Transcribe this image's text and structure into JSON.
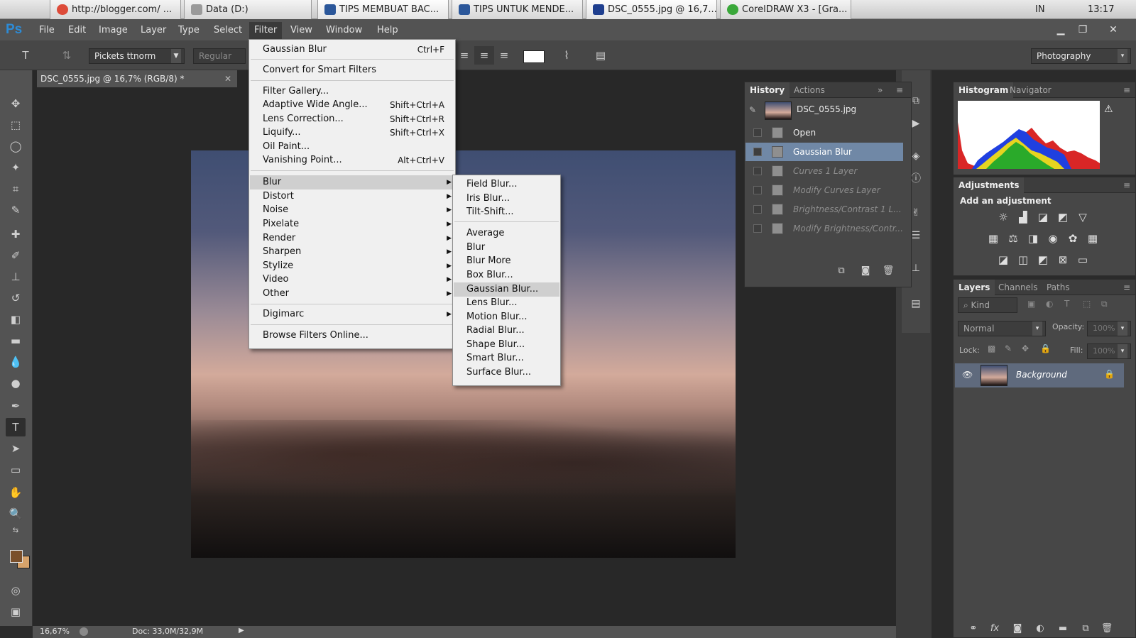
{
  "os": {
    "tabs": [
      {
        "label": "http://blogger.com/ ...",
        "color": "#dd4b39"
      },
      {
        "label": "Data (D:)",
        "color": "#9a9a9a"
      },
      {
        "label": "TIPS MEMBUAT BAC...",
        "color": "#2b579a"
      },
      {
        "label": "TIPS UNTUK MENDE...",
        "color": "#2b579a"
      },
      {
        "label": "DSC_0555.jpg @ 16,7...",
        "color": "#1f3f8f"
      },
      {
        "label": "CorelDRAW X3 - [Gra...",
        "color": "#3aa83a"
      }
    ],
    "lang": "IN",
    "clock": "13:17"
  },
  "app": {
    "logo": "Ps",
    "menu": [
      "File",
      "Edit",
      "Image",
      "Layer",
      "Type",
      "Select",
      "Filter",
      "View",
      "Window",
      "Help"
    ],
    "window_buttons": [
      "▁",
      "❐",
      "✕"
    ]
  },
  "options": {
    "font_family": "Pickets ttnorm",
    "font_style": "Regular",
    "workspace": "Photography",
    "text_color": "#ffffff"
  },
  "document": {
    "tab_title": "DSC_0555.jpg @ 16,7% (RGB/8) *",
    "zoom": "16,67%",
    "doc_size": "Doc: 33,0M/32,9M"
  },
  "filter_menu": {
    "items": [
      {
        "label": "Gaussian Blur",
        "shortcut": "Ctrl+F"
      },
      {
        "label": "Convert for Smart Filters",
        "shortcut": ""
      },
      {
        "label": "Filter Gallery...",
        "shortcut": ""
      },
      {
        "label": "Adaptive Wide Angle...",
        "shortcut": "Shift+Ctrl+A"
      },
      {
        "label": "Lens Correction...",
        "shortcut": "Shift+Ctrl+R"
      },
      {
        "label": "Liquify...",
        "shortcut": "Shift+Ctrl+X"
      },
      {
        "label": "Oil Paint...",
        "shortcut": ""
      },
      {
        "label": "Vanishing Point...",
        "shortcut": "Alt+Ctrl+V"
      },
      {
        "label": "Blur",
        "shortcut": ""
      },
      {
        "label": "Distort",
        "shortcut": ""
      },
      {
        "label": "Noise",
        "shortcut": ""
      },
      {
        "label": "Pixelate",
        "shortcut": ""
      },
      {
        "label": "Render",
        "shortcut": ""
      },
      {
        "label": "Sharpen",
        "shortcut": ""
      },
      {
        "label": "Stylize",
        "shortcut": ""
      },
      {
        "label": "Video",
        "shortcut": ""
      },
      {
        "label": "Other",
        "shortcut": ""
      },
      {
        "label": "Digimarc",
        "shortcut": ""
      },
      {
        "label": "Browse Filters Online...",
        "shortcut": ""
      }
    ]
  },
  "blur_submenu": {
    "items": [
      "Field Blur...",
      "Iris Blur...",
      "Tilt-Shift...",
      "Average",
      "Blur",
      "Blur More",
      "Box Blur...",
      "Gaussian Blur...",
      "Lens Blur...",
      "Motion Blur...",
      "Radial Blur...",
      "Shape Blur...",
      "Smart Blur...",
      "Surface Blur..."
    ]
  },
  "history": {
    "tabs": [
      "History",
      "Actions"
    ],
    "snapshot": "DSC_0555.jpg",
    "states": [
      "Open",
      "Gaussian Blur",
      "Curves 1 Layer",
      "Modify Curves Layer",
      "Brightness/Contrast 1 L...",
      "Modify Brightness/Contr..."
    ]
  },
  "histogram": {
    "tabs": [
      "Histogram",
      "Navigator"
    ]
  },
  "adjustments": {
    "title": "Adjustments",
    "subtitle": "Add an adjustment"
  },
  "layers": {
    "tabs": [
      "Layers",
      "Channels",
      "Paths"
    ],
    "filter": "Kind",
    "blend_mode": "Normal",
    "opacity_label": "Opacity:",
    "opacity": "100%",
    "lock_label": "Lock:",
    "fill_label": "Fill:",
    "fill": "100%",
    "items": [
      {
        "name": "Background"
      }
    ]
  }
}
